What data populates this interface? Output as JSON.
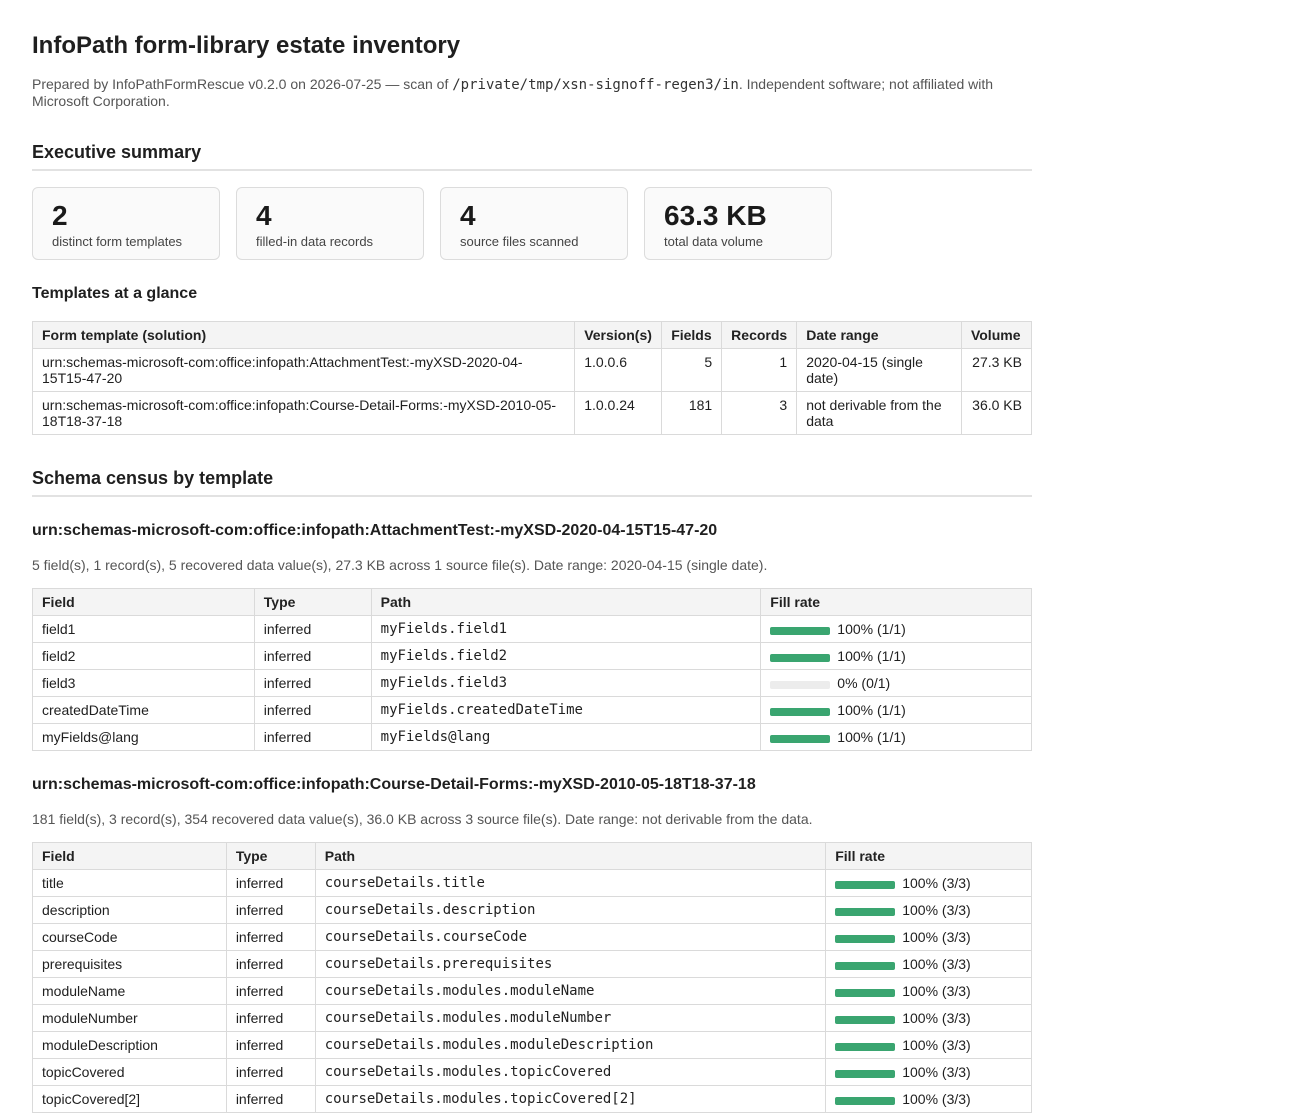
{
  "title": "InfoPath form-library estate inventory",
  "meta": {
    "prefix": "Prepared by InfoPathFormRescue v0.2.0 on 2026-07-25 — scan of ",
    "path": "/private/tmp/xsn-signoff-regen3/in",
    "suffix": ". Independent software; not affiliated with Microsoft Corporation."
  },
  "exec": {
    "heading": "Executive summary",
    "cards": [
      {
        "value": "2",
        "label": "distinct form templates"
      },
      {
        "value": "4",
        "label": "filled-in data records"
      },
      {
        "value": "4",
        "label": "source files scanned"
      },
      {
        "value": "63.3 KB",
        "label": "total data volume"
      }
    ]
  },
  "glance": {
    "heading": "Templates at a glance",
    "columns": [
      "Form template (solution)",
      "Version(s)",
      "Fields",
      "Records",
      "Date range",
      "Volume"
    ],
    "rows": [
      {
        "template": "urn:schemas-microsoft-com:office:infopath:AttachmentTest:-myXSD-2020-04-15T15-47-20",
        "version": "1.0.0.6",
        "fields": "5",
        "records": "1",
        "date_range": "2020-04-15 (single date)",
        "volume": "27.3 KB"
      },
      {
        "template": "urn:schemas-microsoft-com:office:infopath:Course-Detail-Forms:-myXSD-2010-05-18T18-37-18",
        "version": "1.0.0.24",
        "fields": "181",
        "records": "3",
        "date_range": "not derivable from the data",
        "volume": "36.0 KB"
      }
    ]
  },
  "schema": {
    "heading": "Schema census by template",
    "columns": [
      "Field",
      "Type",
      "Path",
      "Fill rate"
    ],
    "templates": [
      {
        "name": "urn:schemas-microsoft-com:office:infopath:AttachmentTest:-myXSD-2020-04-15T15-47-20",
        "summary": "5 field(s), 1 record(s), 5 recovered data value(s), 27.3 KB across 1 source file(s). Date range: 2020-04-15 (single date).",
        "fields": [
          {
            "field": "field1",
            "type": "inferred",
            "path": "myFields.field1",
            "fill": 1.0,
            "fill_text": "100% (1/1)"
          },
          {
            "field": "field2",
            "type": "inferred",
            "path": "myFields.field2",
            "fill": 1.0,
            "fill_text": "100% (1/1)"
          },
          {
            "field": "field3",
            "type": "inferred",
            "path": "myFields.field3",
            "fill": 0.0,
            "fill_text": "0% (0/1)"
          },
          {
            "field": "createdDateTime",
            "type": "inferred",
            "path": "myFields.createdDateTime",
            "fill": 1.0,
            "fill_text": "100% (1/1)"
          },
          {
            "field": "myFields@lang",
            "type": "inferred",
            "path": "myFields@lang",
            "fill": 1.0,
            "fill_text": "100% (1/1)"
          }
        ]
      },
      {
        "name": "urn:schemas-microsoft-com:office:infopath:Course-Detail-Forms:-myXSD-2010-05-18T18-37-18",
        "summary": "181 field(s), 3 record(s), 354 recovered data value(s), 36.0 KB across 3 source file(s). Date range: not derivable from the data.",
        "fields": [
          {
            "field": "title",
            "type": "inferred",
            "path": "courseDetails.title",
            "fill": 1.0,
            "fill_text": "100% (3/3)"
          },
          {
            "field": "description",
            "type": "inferred",
            "path": "courseDetails.description",
            "fill": 1.0,
            "fill_text": "100% (3/3)"
          },
          {
            "field": "courseCode",
            "type": "inferred",
            "path": "courseDetails.courseCode",
            "fill": 1.0,
            "fill_text": "100% (3/3)"
          },
          {
            "field": "prerequisites",
            "type": "inferred",
            "path": "courseDetails.prerequisites",
            "fill": 1.0,
            "fill_text": "100% (3/3)"
          },
          {
            "field": "moduleName",
            "type": "inferred",
            "path": "courseDetails.modules.moduleName",
            "fill": 1.0,
            "fill_text": "100% (3/3)"
          },
          {
            "field": "moduleNumber",
            "type": "inferred",
            "path": "courseDetails.modules.moduleNumber",
            "fill": 1.0,
            "fill_text": "100% (3/3)"
          },
          {
            "field": "moduleDescription",
            "type": "inferred",
            "path": "courseDetails.modules.moduleDescription",
            "fill": 1.0,
            "fill_text": "100% (3/3)"
          },
          {
            "field": "topicCovered",
            "type": "inferred",
            "path": "courseDetails.modules.topicCovered",
            "fill": 1.0,
            "fill_text": "100% (3/3)"
          },
          {
            "field": "topicCovered[2]",
            "type": "inferred",
            "path": "courseDetails.modules.topicCovered[2]",
            "fill": 1.0,
            "fill_text": "100% (3/3)"
          }
        ]
      }
    ]
  },
  "colors": {
    "fill_bar": "#3aa570",
    "fill_track": "#ececec"
  }
}
